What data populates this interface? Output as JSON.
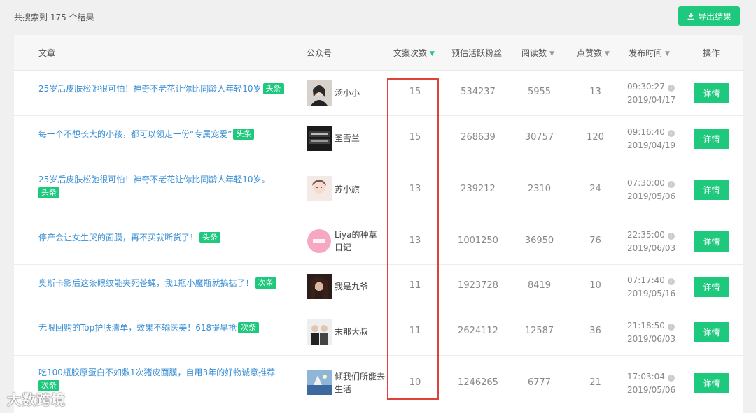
{
  "summary": "共搜索到 175 个结果",
  "export_label": "导出结果",
  "columns": {
    "article": "文章",
    "account": "公众号",
    "copies": "文案次数",
    "fans": "预估活跃粉丝",
    "reads": "阅读数",
    "likes": "点赞数",
    "publish": "发布时间",
    "action": "操作"
  },
  "detail_label": "详情",
  "rows": [
    {
      "title": "25岁后皮肤松弛很可怕！神奇不老花让你比同龄人年轻10岁",
      "tag": "头条",
      "account": "汤小小",
      "copies": "15",
      "fans": "534237",
      "reads": "5955",
      "likes": "13",
      "time": "09:30:27",
      "date": "2019/04/17"
    },
    {
      "title": "每一个不想长大的小孩，都可以领走一份“专属宠爱”",
      "tag": "头条",
      "account": "圣雪兰",
      "copies": "15",
      "fans": "268639",
      "reads": "30757",
      "likes": "120",
      "time": "09:16:40",
      "date": "2019/04/19"
    },
    {
      "title": "25岁后皮肤松弛很可怕！神奇不老花让你比同龄人年轻10岁。",
      "tag": "头条",
      "account": "苏小旗",
      "copies": "13",
      "fans": "239212",
      "reads": "2310",
      "likes": "24",
      "time": "07:30:00",
      "date": "2019/05/06"
    },
    {
      "title": "停产会让女生哭的面膜，再不买就断货了！",
      "tag": "头条",
      "account": "Liya的种草日记",
      "copies": "13",
      "fans": "1001250",
      "reads": "36950",
      "likes": "76",
      "time": "22:35:00",
      "date": "2019/06/03"
    },
    {
      "title": "奥斯卡影后这条眼纹能夹死苍蝇，我1瓶小魔瓶就搞掂了！",
      "tag": "次条",
      "account": "我是九爷",
      "copies": "11",
      "fans": "1923728",
      "reads": "8419",
      "likes": "10",
      "time": "07:17:40",
      "date": "2019/05/16"
    },
    {
      "title": "无限回购的Top护肤清单，效果不输医美！618提早抢",
      "tag": "次条",
      "account": "末那大叔",
      "copies": "11",
      "fans": "2624112",
      "reads": "12587",
      "likes": "36",
      "time": "21:18:50",
      "date": "2019/06/03"
    },
    {
      "title": "吃100瓶胶原蛋白不如敷1次猪皮面膜，自用3年的好物诚意推荐",
      "tag": "次条",
      "account": "倾我们所能去生活",
      "copies": "10",
      "fans": "1246265",
      "reads": "6777",
      "likes": "21",
      "time": "17:03:04",
      "date": "2019/05/06"
    }
  ],
  "watermark": "大数跨境",
  "colors": {
    "accent": "#1ec87d",
    "link": "#3b8fd4",
    "highlight": "#e0413a"
  }
}
